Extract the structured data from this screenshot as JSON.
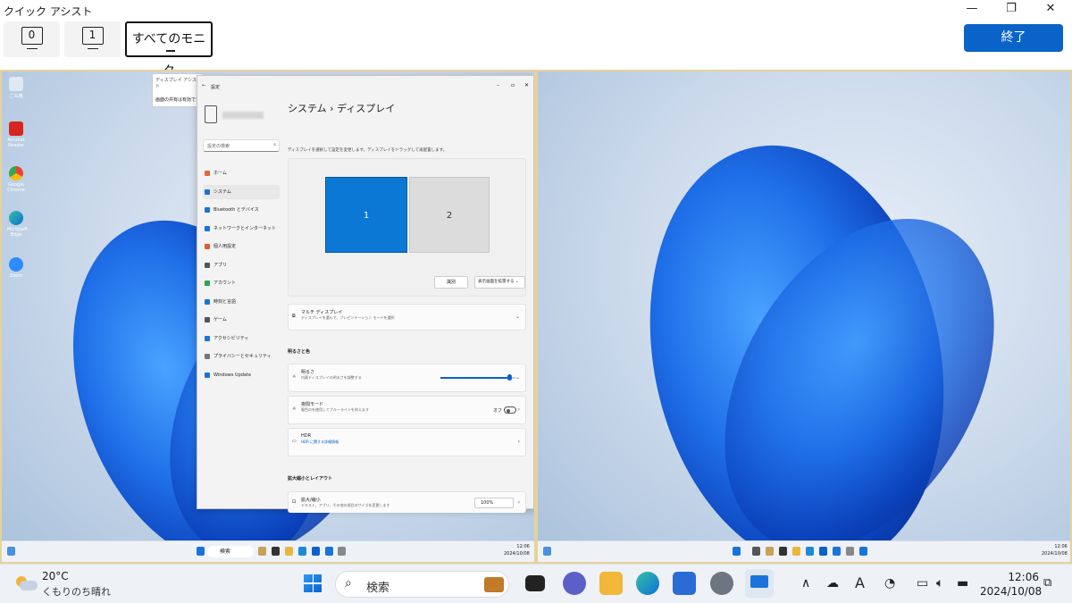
{
  "window": {
    "title": "クイック アシスト",
    "minimize_icon": "—",
    "restore_icon": "❐",
    "close_icon": "✕"
  },
  "toolbar": {
    "monitor_buttons": [
      {
        "label": "0"
      },
      {
        "label": "1"
      }
    ],
    "all_monitors_label": "すべてのモニタ",
    "end_label": "終了"
  },
  "remote_left": {
    "desktop_icons": [
      "ごみ箱",
      "Acrobat Reader",
      "Google Chrome",
      "Microsoft Edge",
      "Zoom"
    ],
    "tooltip": {
      "title": "ディスプレイ アシスト",
      "body": "画面の共有は有効です"
    },
    "settings": {
      "back_icon": "←",
      "window_title": "設定",
      "search_placeholder": "設定の検索",
      "breadcrumb_parent": "システム",
      "breadcrumb_sep": "›",
      "breadcrumb_current": "ディスプレイ",
      "hint": "ディスプレイを選択して設定を変更します。ディスプレイをドラッグして再配置します。",
      "display1": "1",
      "display2": "2",
      "identify": "識別",
      "extend": "表示画面を拡張する",
      "nav": [
        {
          "label": "ホーム",
          "color": "#e0683a"
        },
        {
          "label": "システム",
          "color": "#1b73d9"
        },
        {
          "label": "Bluetooth とデバイス",
          "color": "#1b73d9"
        },
        {
          "label": "ネットワークとインターネット",
          "color": "#1b73d9"
        },
        {
          "label": "個人用設定",
          "color": "#d4622a"
        },
        {
          "label": "アプリ",
          "color": "#555555"
        },
        {
          "label": "アカウント",
          "color": "#2ea44f"
        },
        {
          "label": "時刻と言語",
          "color": "#1b73d9"
        },
        {
          "label": "ゲーム",
          "color": "#555555"
        },
        {
          "label": "アクセシビリティ",
          "color": "#1b73d9"
        },
        {
          "label": "プライバシーとセキュリティ",
          "color": "#777777"
        },
        {
          "label": "Windows Update",
          "color": "#1b73d9"
        }
      ],
      "multi_title": "マルチ ディスプレイ",
      "multi_sub": "ディスプレイを選んで、プレゼンテーション モードを選択",
      "section_brightness": "明るさと色",
      "brightness_title": "明るさ",
      "brightness_sub": "内蔵ディスプレイの明るさを調整する",
      "brightness_level": 0.92,
      "night_title": "夜間モード",
      "night_sub": "暖色のを使用してブルーライトを抑えます",
      "night_state": "オフ",
      "hdr_title": "HDR",
      "hdr_sub": "HDR に関する詳細情報",
      "section_scale": "拡大縮小とレイアウト",
      "scale_title": "拡大/縮小",
      "scale_sub": "テキスト、アプリ、その他の項目のサイズを変更します",
      "scale_value": "100%"
    },
    "task_search": "検索",
    "task_time": "12:06",
    "task_date": "2024/10/08"
  },
  "remote_right": {
    "task_time": "12:06",
    "task_date": "2024/10/08"
  },
  "taskbar": {
    "weather_temp": "20°C",
    "weather_desc": "くもりのち晴れ",
    "search_label": "検索",
    "time": "12:06",
    "date": "2024/10/08",
    "ime_label": "A",
    "accent": "#0a63c8"
  }
}
